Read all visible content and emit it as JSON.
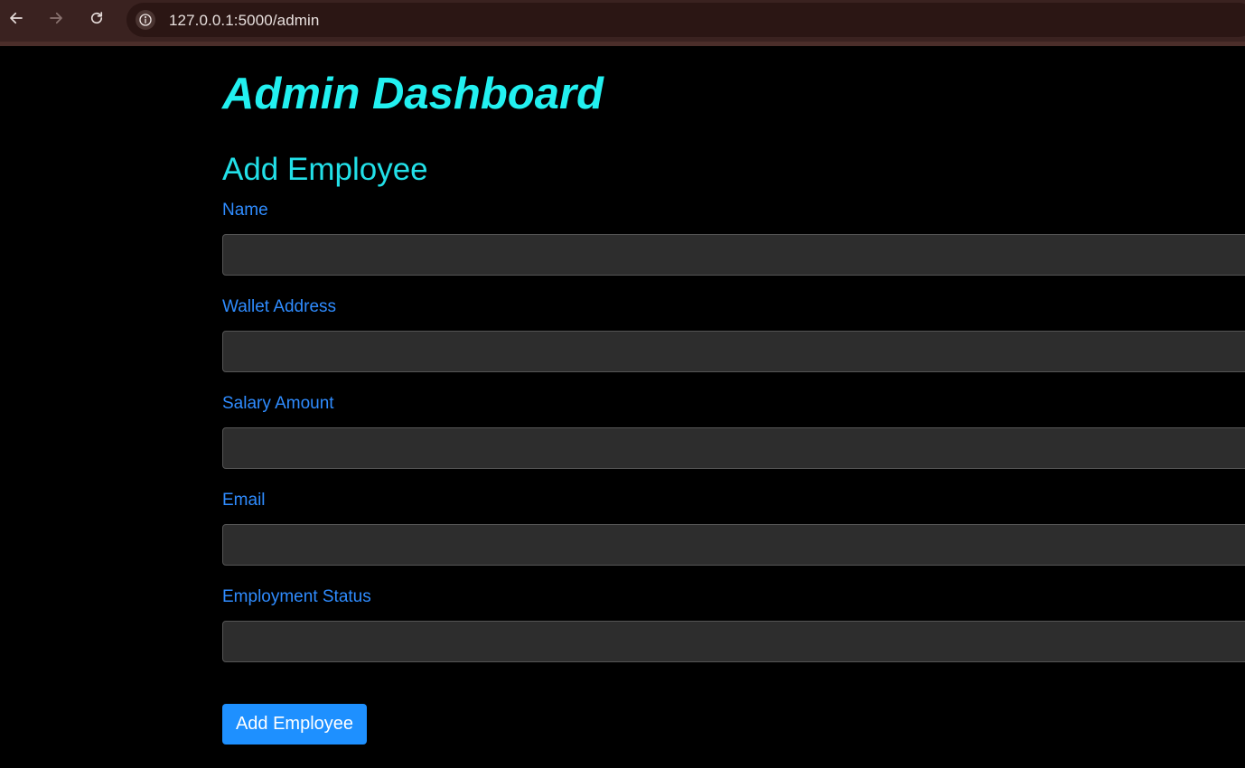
{
  "browser": {
    "url": "127.0.0.1:5000/admin",
    "back_icon": "arrow-left-icon",
    "forward_icon": "arrow-right-icon",
    "reload_icon": "reload-icon",
    "site_info_icon": "info-icon"
  },
  "page": {
    "title": "Admin Dashboard",
    "section_title": "Add Employee"
  },
  "form": {
    "fields": [
      {
        "label": "Name",
        "value": "",
        "placeholder": ""
      },
      {
        "label": "Wallet Address",
        "value": "",
        "placeholder": ""
      },
      {
        "label": "Salary Amount",
        "value": "",
        "placeholder": ""
      },
      {
        "label": "Email",
        "value": "",
        "placeholder": ""
      },
      {
        "label": "Employment Status",
        "value": "",
        "placeholder": ""
      }
    ],
    "submit_label": "Add Employee"
  },
  "colors": {
    "title": "#22f0f0",
    "label": "#2f8cff",
    "button": "#1e90ff",
    "input_bg": "#2d2d2d",
    "page_bg": "#000000"
  }
}
